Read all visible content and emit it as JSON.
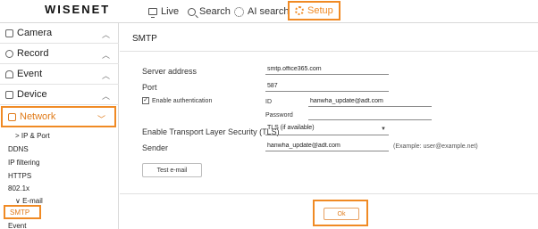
{
  "brand": {
    "logo": "WISENET",
    "accent": "#f08a24"
  },
  "topnav": {
    "live": "Live",
    "search": "Search",
    "ai_search": "AI search",
    "setup": "Setup",
    "icons": [
      "monitor-icon",
      "search-icon",
      "ai-search-icon",
      "gear-icon"
    ]
  },
  "sidebar": {
    "items": [
      {
        "label": "Camera",
        "icon": "camera-icon"
      },
      {
        "label": "Record",
        "icon": "record-icon"
      },
      {
        "label": "Event",
        "icon": "bell-icon"
      },
      {
        "label": "Device",
        "icon": "device-icon"
      },
      {
        "label": "Network",
        "icon": "network-icon",
        "active": true
      }
    ],
    "sub": {
      "ip_port": "> IP & Port",
      "ddns": "DDNS",
      "ip_filtering": "IP filtering",
      "https": "HTTPS",
      "dot1x": "802.1x",
      "email": "∨ E-mail",
      "smtp": "SMTP",
      "event": "Event"
    }
  },
  "main": {
    "title": "SMTP",
    "server_address": {
      "label": "Server address",
      "value": "smtp.office365.com"
    },
    "port": {
      "label": "Port",
      "value": "587"
    },
    "enable_auth": {
      "label": "Enable authentication",
      "checked": true
    },
    "id": {
      "label": "ID",
      "value": "hanwha_update@adt.com"
    },
    "password": {
      "label": "Password",
      "value": ""
    },
    "tls": {
      "label": "Enable Transport Layer Security (TLS)",
      "value": "TLS (if available)"
    },
    "sender": {
      "label": "Sender",
      "value": "hanwha_update@adt.com",
      "hint": "(Example: user@example.net)"
    },
    "test_button": "Test e-mail",
    "ok_button": "Ok"
  }
}
